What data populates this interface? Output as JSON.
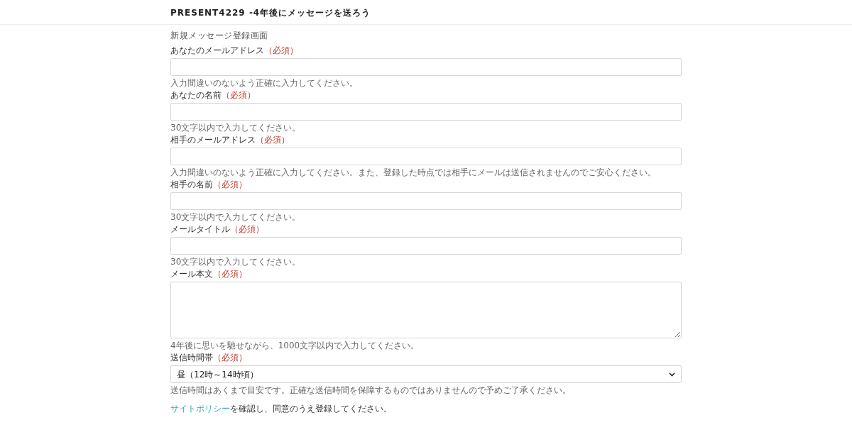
{
  "header": {
    "title": "PRESENT4229 -4年後にメッセージを送ろう"
  },
  "page_title": "新規メッセージ登録画面",
  "fields": [
    {
      "kind": "input",
      "label": "あなたのメールアドレス",
      "required": "（必須）",
      "hint": "入力間違いのないよう正確に入力してください。"
    },
    {
      "kind": "input",
      "label": "あなたの名前",
      "required": "（必須）",
      "hint": "30文字以内で入力してください。"
    },
    {
      "kind": "input",
      "label": "相手のメールアドレス",
      "required": "（必須）",
      "hint": "入力間違いのないよう正確に入力してください。また、登録した時点では相手にメールは送信されませんのでご安心ください。"
    },
    {
      "kind": "input",
      "label": "相手の名前",
      "required": "（必須）",
      "hint": "30文字以内で入力してください。"
    },
    {
      "kind": "input",
      "label": "メールタイトル",
      "required": "（必須）",
      "hint": "30文字以内で入力してください。"
    },
    {
      "kind": "textarea",
      "label": "メール本文",
      "required": "（必須）",
      "hint": "4年後に思いを馳せながら、1000文字以内で入力してください。"
    },
    {
      "kind": "select",
      "label": "送信時間帯",
      "required": "（必須）",
      "value": "昼（12時～14時頃）",
      "hint": "送信時間はあくまで目安です。正確な送信時間を保障するものではありませんので予めご了承ください。"
    }
  ],
  "policy": {
    "link": "サイトポリシー",
    "text": "を確認し、同意のうえ登録してください。"
  }
}
